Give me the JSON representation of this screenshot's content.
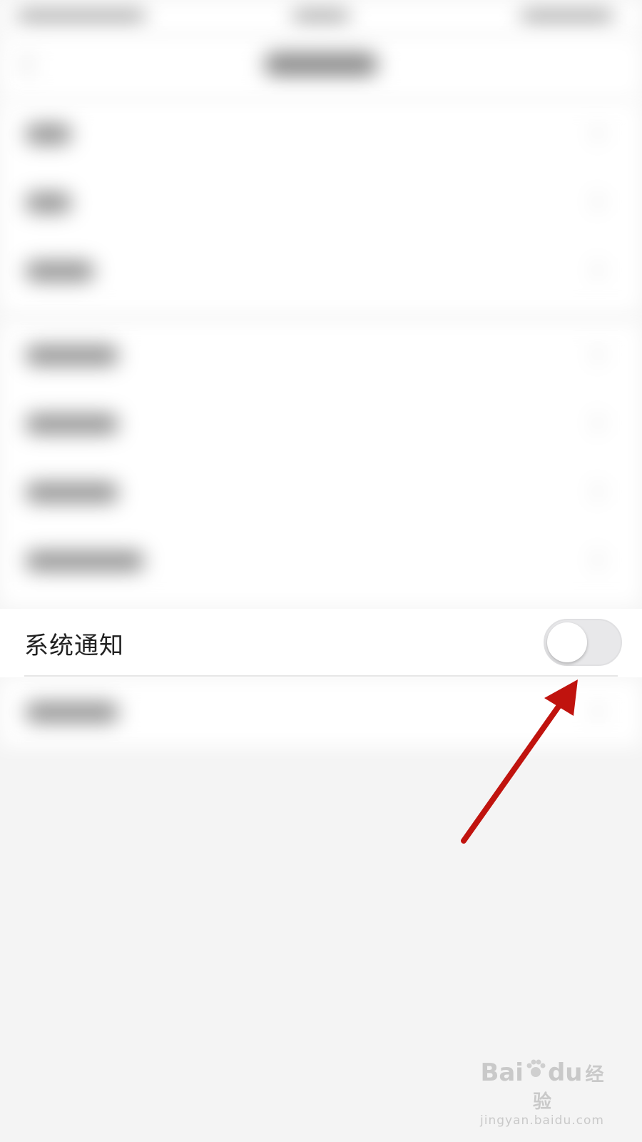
{
  "system_notification": {
    "label": "系统通知",
    "toggle_on": false
  },
  "watermark": {
    "brand_left": "Bai",
    "brand_right": "du",
    "brand_cn": "经验",
    "domain": "jingyan.baidu.com"
  },
  "colors": {
    "arrow": "#c0130e",
    "toggle_off": "#e8e8ea",
    "page_background": "#f4f4f4"
  }
}
